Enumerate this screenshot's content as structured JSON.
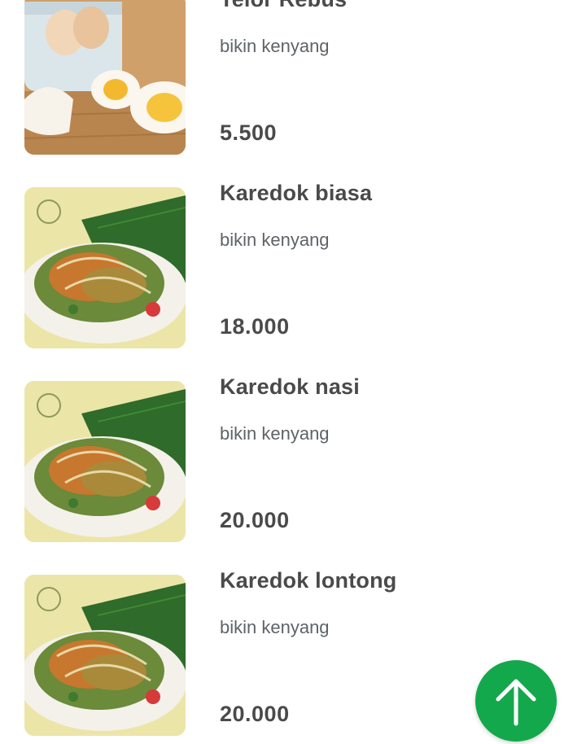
{
  "menu": {
    "items": [
      {
        "name": "Telor Rebus",
        "description": "bikin kenyang",
        "price": "5.500",
        "image": "boiled-eggs-photo"
      },
      {
        "name": "Karedok biasa",
        "description": "bikin kenyang",
        "price": "18.000",
        "image": "karedok-salad-photo"
      },
      {
        "name": "Karedok nasi",
        "description": "bikin kenyang",
        "price": "20.000",
        "image": "karedok-salad-photo"
      },
      {
        "name": "Karedok lontong",
        "description": "bikin kenyang",
        "price": "20.000",
        "image": "karedok-salad-photo"
      }
    ]
  },
  "scroll_top_button": {
    "icon": "arrow-up-icon",
    "color": "#14a84c"
  },
  "colors": {
    "text": "#4a4a4a",
    "muted": "#5f6368",
    "accent": "#14a84c"
  }
}
